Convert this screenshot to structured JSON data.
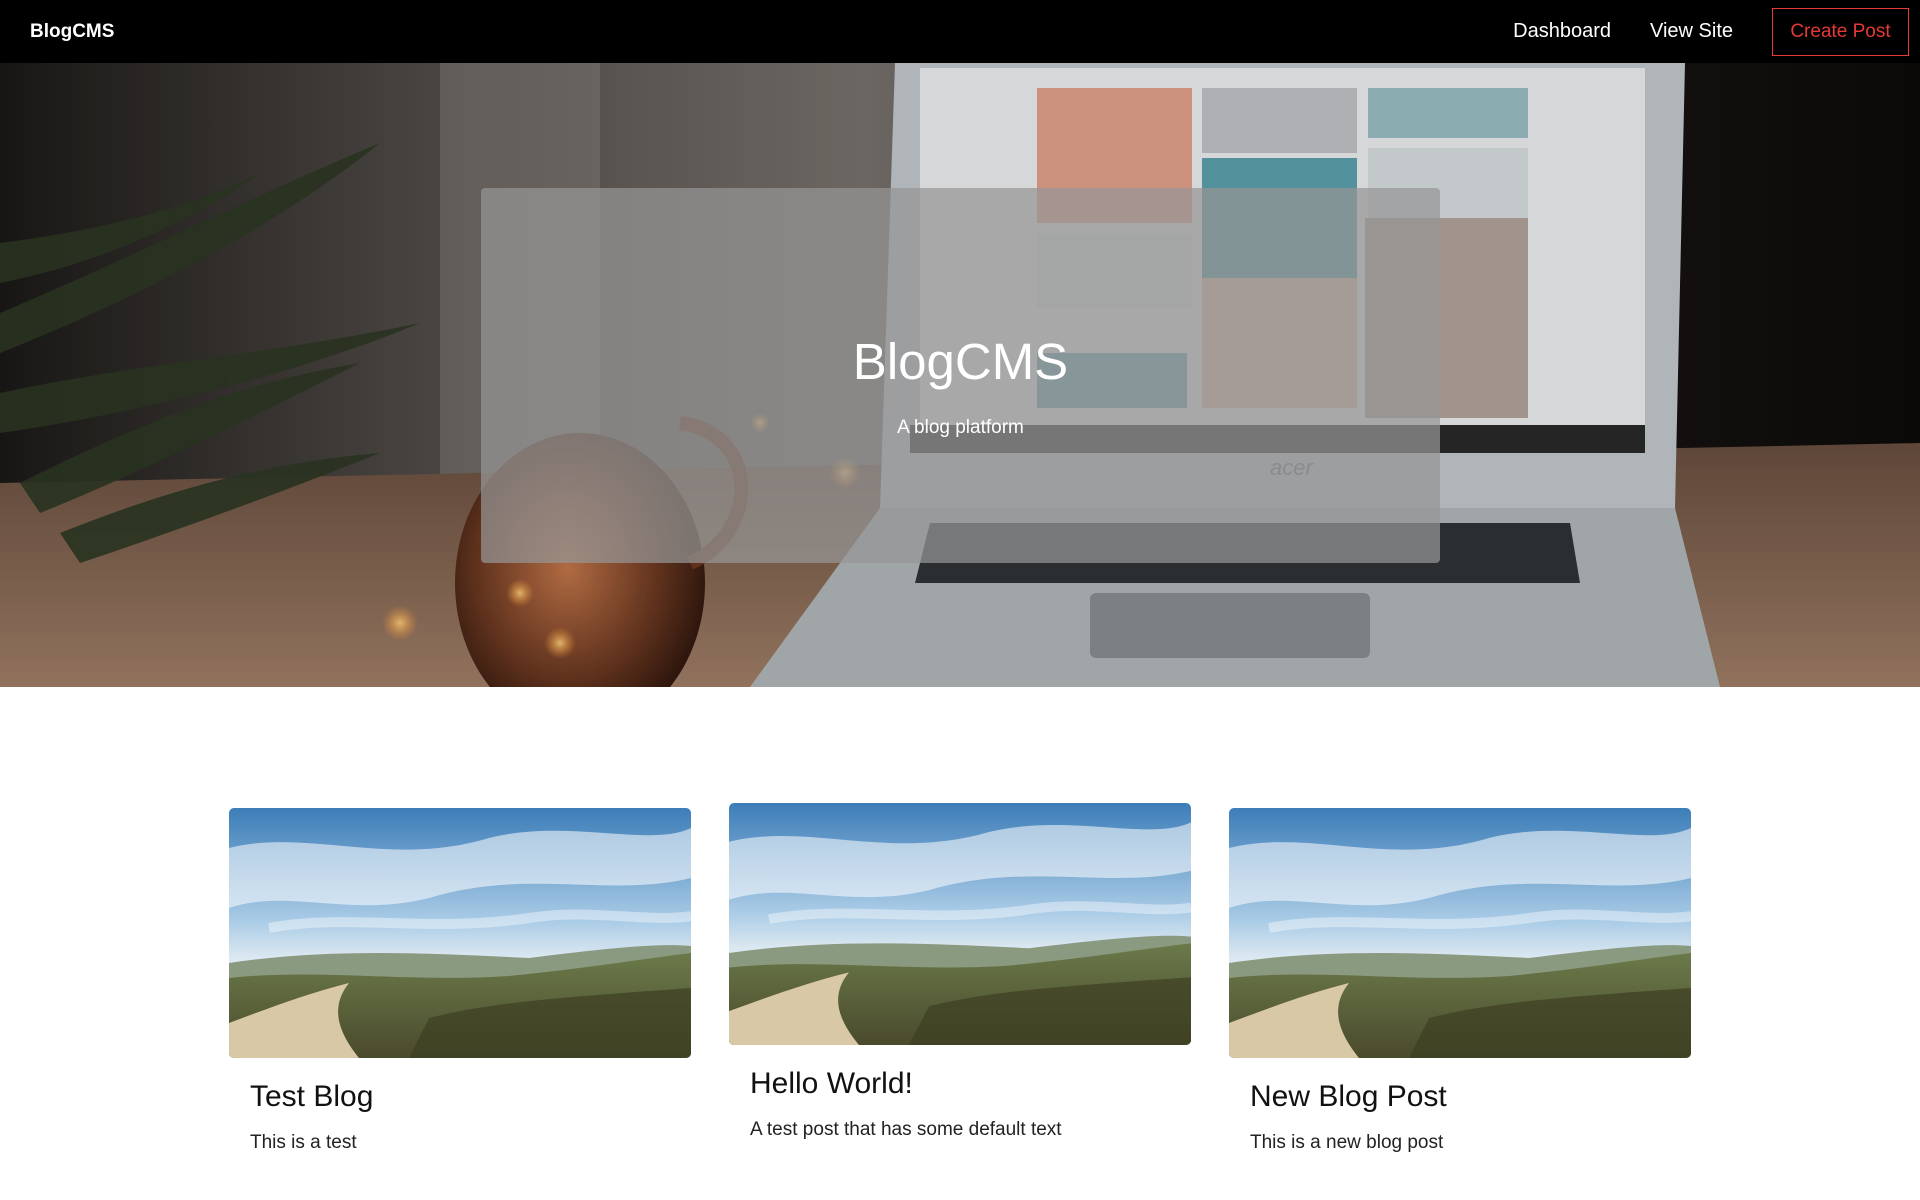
{
  "navbar": {
    "brand": "BlogCMS",
    "links": {
      "dashboard": "Dashboard",
      "view_site": "View Site",
      "create_post": "Create Post"
    },
    "accent_color": "#e53935"
  },
  "hero": {
    "title": "BlogCMS",
    "subtitle": "A blog platform",
    "laptop_brand": "acer",
    "background_image": "desk-laptop-photo"
  },
  "posts": [
    {
      "title": "Test Blog",
      "excerpt": "This is a test",
      "image": "landscape-hills-photo"
    },
    {
      "title": "Hello World!",
      "excerpt": "A test post that has some default text",
      "image": "landscape-hills-photo"
    },
    {
      "title": "New Blog Post",
      "excerpt": "This is a new blog post",
      "image": "landscape-hills-photo"
    }
  ]
}
